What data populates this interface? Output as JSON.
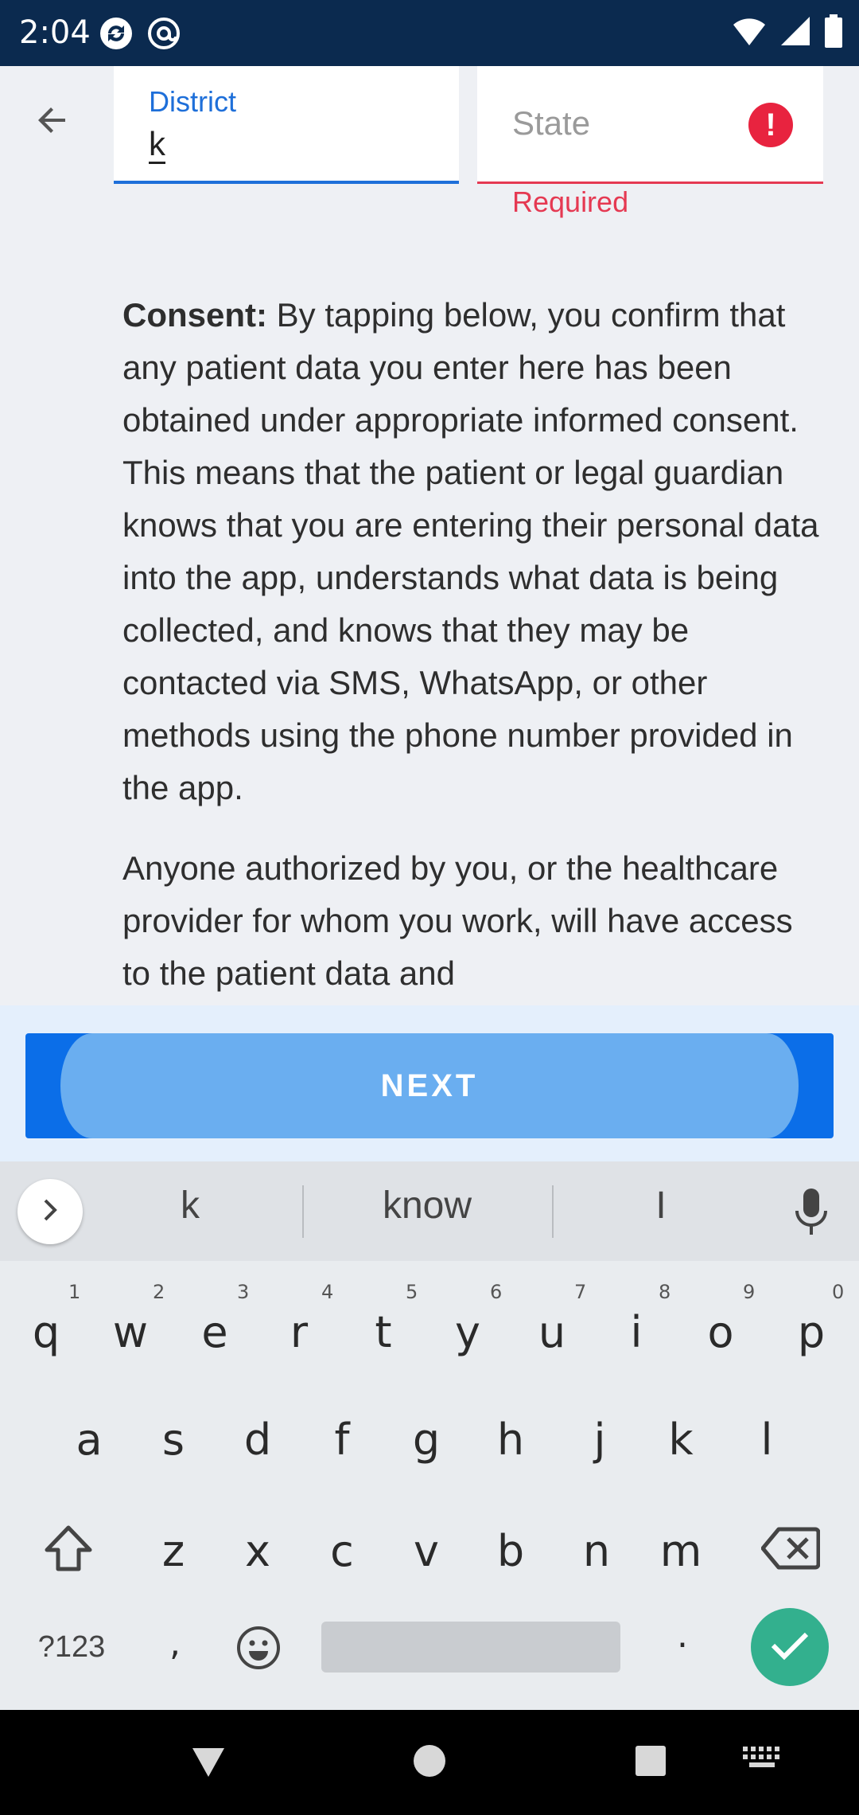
{
  "status_bar": {
    "time": "2:04",
    "app_icons": [
      "sync-icon",
      "at-icon"
    ],
    "right_icons": [
      "wifi-icon",
      "signal-icon",
      "battery-icon"
    ]
  },
  "header": {
    "back_icon": "arrow-back-icon",
    "district": {
      "label": "District",
      "value": "k"
    },
    "state": {
      "placeholder": "State",
      "error_text": "Required",
      "error_icon": "alert-icon",
      "error_color": "#e53952"
    }
  },
  "consent": {
    "bold_lead": "Consent:",
    "paragraph1_rest": " By tapping below, you confirm that any patient data you enter here has been obtained under appropriate informed consent. This means that the patient or legal guardian knows that you are entering their personal data into the app, understands what data is being collected, and knows that they may be contacted via SMS, WhatsApp, or other methods using the phone number provided in the app.",
    "paragraph2": "Anyone authorized by you, or the healthcare provider for whom you work, will have access to the patient data and"
  },
  "actions": {
    "next_label": "NEXT",
    "accent_color": "#0b6ee8"
  },
  "keyboard": {
    "suggestions": [
      "k",
      "know",
      "I"
    ],
    "row1": [
      {
        "key": "q",
        "hint": "1"
      },
      {
        "key": "w",
        "hint": "2"
      },
      {
        "key": "e",
        "hint": "3"
      },
      {
        "key": "r",
        "hint": "4"
      },
      {
        "key": "t",
        "hint": "5"
      },
      {
        "key": "y",
        "hint": "6"
      },
      {
        "key": "u",
        "hint": "7"
      },
      {
        "key": "i",
        "hint": "8"
      },
      {
        "key": "o",
        "hint": "9"
      },
      {
        "key": "p",
        "hint": "0"
      }
    ],
    "row2": [
      "a",
      "s",
      "d",
      "f",
      "g",
      "h",
      "j",
      "k",
      "l"
    ],
    "row3": [
      "z",
      "x",
      "c",
      "v",
      "b",
      "n",
      "m"
    ],
    "symbols_label": "?123",
    "comma": ",",
    "period": "."
  },
  "nav_bar": {
    "icons": [
      "back-triangle-icon",
      "home-circle-icon",
      "recents-square-icon",
      "keyboard-switch-icon"
    ]
  }
}
